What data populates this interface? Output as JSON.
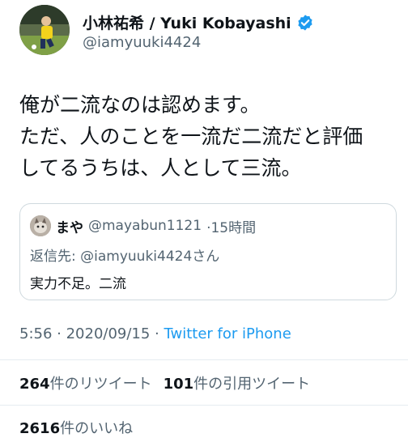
{
  "author": {
    "display_name": "小林祐希 / Yuki Kobayashi",
    "handle": "@iamyuuki4424",
    "verified": true
  },
  "tweet": {
    "line1": "俺が二流なのは認めます。",
    "line2": "ただ、人のことを一流だ二流だと評価",
    "line3": "してるうちは、人として三流。"
  },
  "quote": {
    "name": "まや",
    "handle": "@mayabun1121",
    "time": "·15時間",
    "reply_prefix": "返信先: ",
    "reply_handle": "@iamyuuki4424",
    "reply_suffix": "さん",
    "text": "実力不足。二流"
  },
  "meta": {
    "time": "5:56 · 2020/09/15 · ",
    "source": "Twitter for iPhone"
  },
  "stats": {
    "retweet_count": "264",
    "retweet_label": "件のリツイート",
    "quote_count": "101",
    "quote_label": "件の引用ツイート",
    "like_count": "2616",
    "like_label": "件のいいね"
  },
  "colors": {
    "link": "#1d9bf0",
    "secondary_text": "#536471",
    "verified_badge": "#1d9bf0"
  },
  "icons": [
    "verified-badge-icon"
  ]
}
